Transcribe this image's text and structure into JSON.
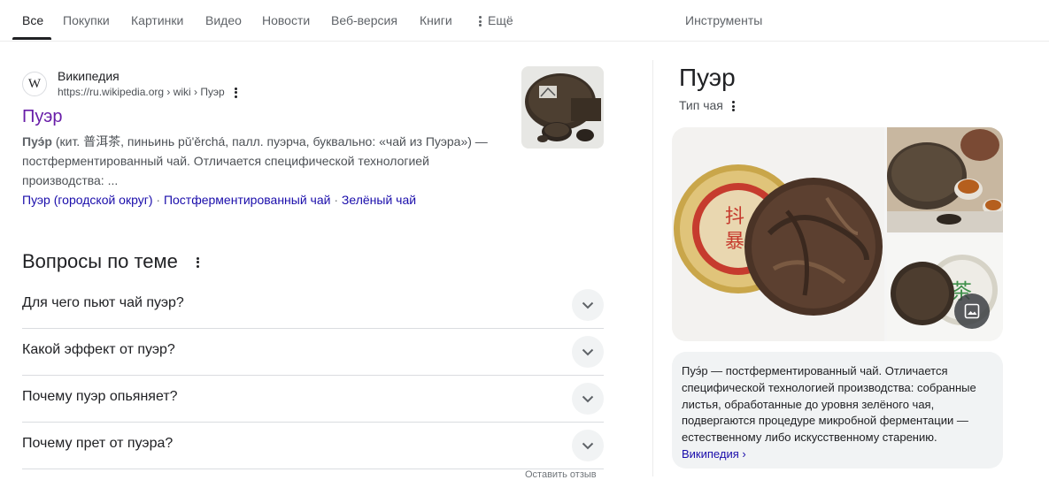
{
  "tabs": {
    "items": [
      {
        "label": "Все"
      },
      {
        "label": "Покупки"
      },
      {
        "label": "Картинки"
      },
      {
        "label": "Видео"
      },
      {
        "label": "Новости"
      },
      {
        "label": "Веб-версия"
      },
      {
        "label": "Книги"
      }
    ],
    "more_label": "Ещё",
    "tools_label": "Инструменты"
  },
  "result": {
    "source_logo": "W",
    "source_name": "Википедия",
    "url": "https://ru.wikipedia.org › wiki › Пуэр",
    "title": "Пуэр",
    "snippet_bold": "Пуэ́р",
    "snippet_rest": " (кит. 普洱茶, пиньинь pǔ'ěrchá, палл. пуэрча, буквально: «чай из Пуэра») — постферментированный чай. Отличается специфической технологией производства: ...",
    "sitelinks": [
      {
        "label": "Пуэр (городской округ)"
      },
      {
        "label": "Постферментированный чай"
      },
      {
        "label": "Зелёный чай"
      }
    ],
    "sitelink_separator": " · "
  },
  "related_questions": {
    "title": "Вопросы по теме",
    "items": [
      {
        "question": "Для чего пьют чай пуэр?"
      },
      {
        "question": "Какой эффект от пуэр?"
      },
      {
        "question": "Почему пуэр опьяняет?"
      },
      {
        "question": "Почему прет от пуэра?"
      }
    ],
    "feedback_label": "Оставить отзыв"
  },
  "knowledge_panel": {
    "title": "Пуэр",
    "subtitle": "Тип чая",
    "description": "Пуэ́р — постферментированный чай. Отличается специфической технологией производства: собранные листья, обработанные до уровня зелёного чая, подвергаются процедуре микробной ферментации — естественному либо искусственному старению. ",
    "source_link": "Википедия ›"
  },
  "colors": {
    "visited_link": "#681da8",
    "link": "#1a0dab",
    "text": "#202124",
    "muted": "#4d5156"
  }
}
